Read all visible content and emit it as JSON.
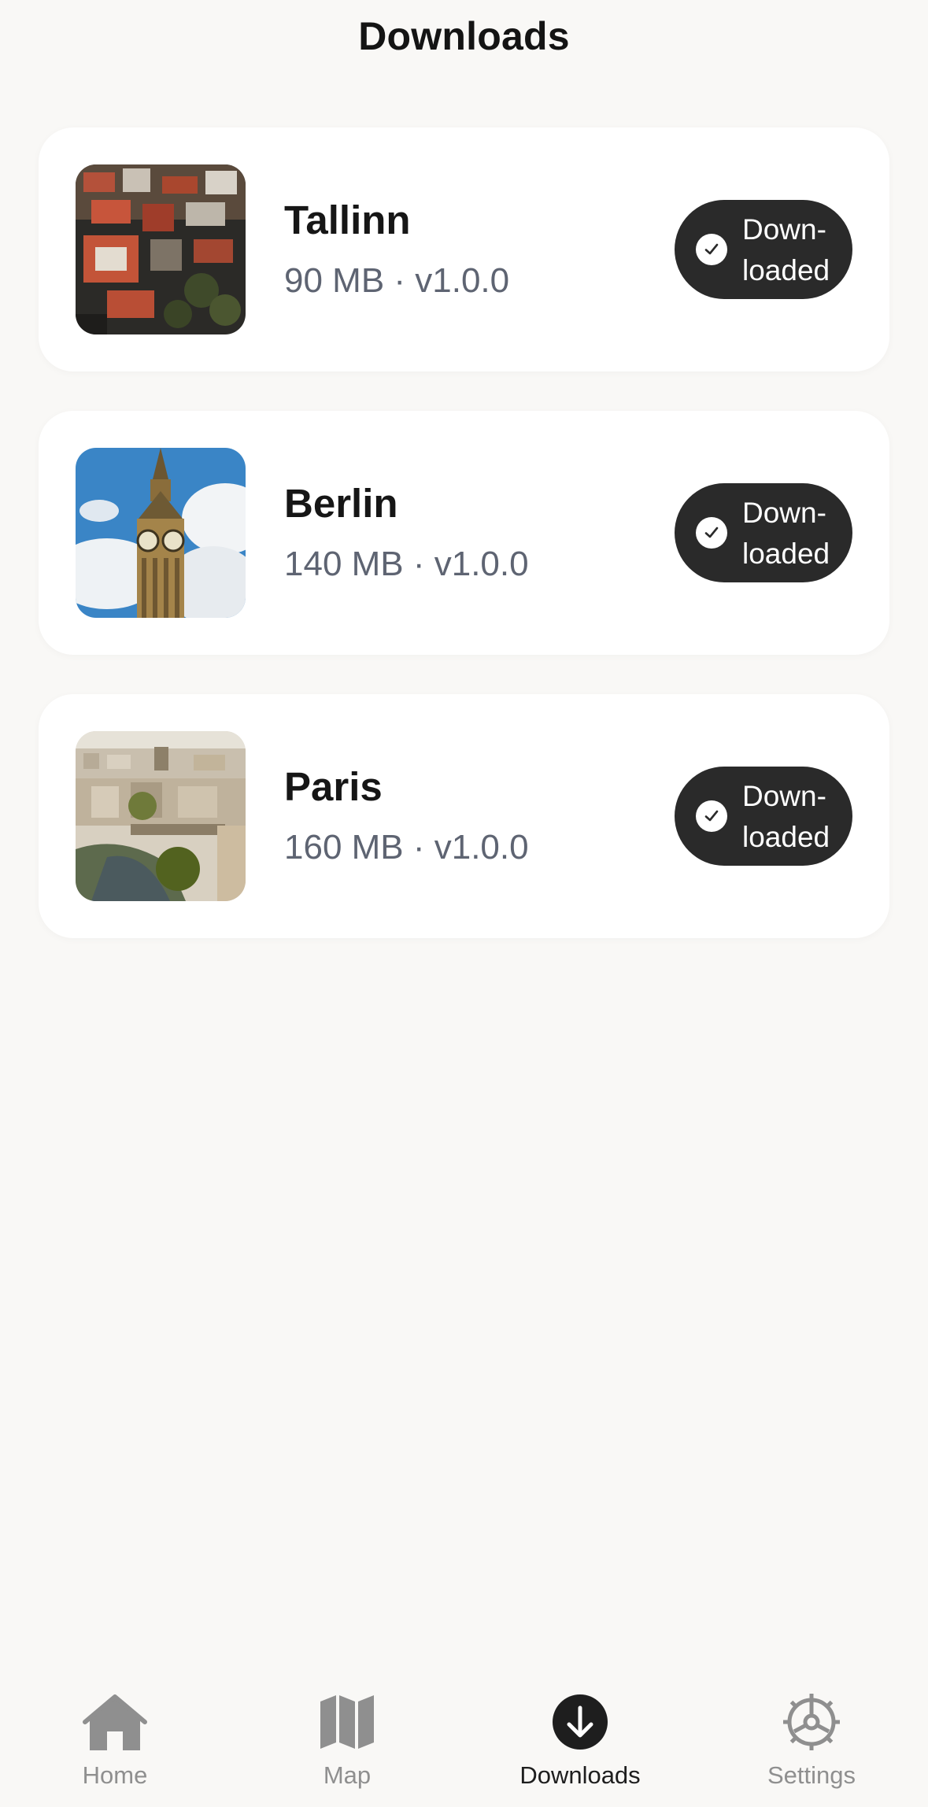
{
  "header": {
    "title": "Downloads"
  },
  "downloads": [
    {
      "name": "Tallinn",
      "meta": "90 MB · v1.0.0",
      "status_line1": "Down-",
      "status_line2": "loaded"
    },
    {
      "name": "Berlin",
      "meta": "140 MB · v1.0.0",
      "status_line1": "Down-",
      "status_line2": "loaded"
    },
    {
      "name": "Paris",
      "meta": "160 MB · v1.0.0",
      "status_line1": "Down-",
      "status_line2": "loaded"
    }
  ],
  "tabbar": {
    "items": [
      {
        "label": "Home",
        "icon": "home-icon"
      },
      {
        "label": "Map",
        "icon": "map-icon"
      },
      {
        "label": "Downloads",
        "icon": "download-icon",
        "active": true
      },
      {
        "label": "Settings",
        "icon": "gear-icon"
      }
    ]
  },
  "colors": {
    "background": "#f9f8f6",
    "card": "#ffffff",
    "status_button": "#2a2a2a",
    "meta_text": "#5e6472",
    "inactive_tab": "#8f8f8f"
  }
}
